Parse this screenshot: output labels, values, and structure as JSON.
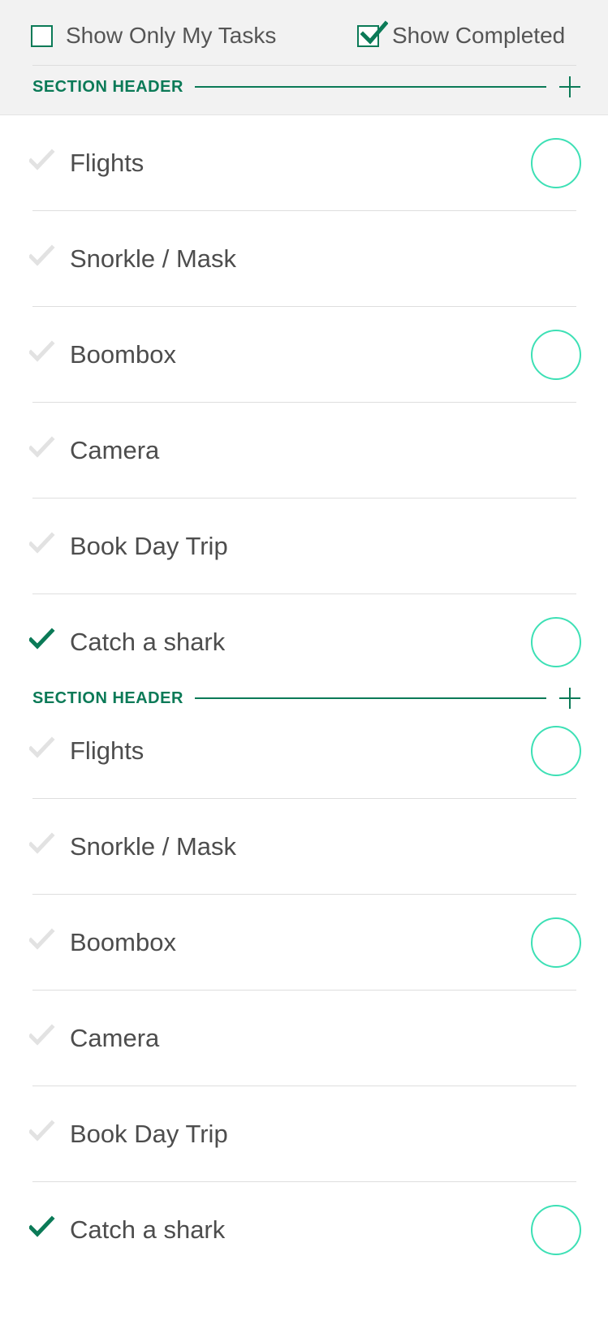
{
  "colors": {
    "accent": "#0b7a57",
    "ring": "#3de0b5",
    "check_inactive": "#e2e2e2",
    "text": "#4d4d4d"
  },
  "filters": {
    "show_only_my_tasks": {
      "label": "Show Only My Tasks",
      "checked": false
    },
    "show_completed": {
      "label": "Show Completed",
      "checked": true
    }
  },
  "sections": [
    {
      "header": "SECTION HEADER",
      "tasks": [
        {
          "title": "Flights",
          "completed": false,
          "assignees": [
            "person-glasses-plaid",
            "person-faded"
          ]
        },
        {
          "title": "Snorkle / Mask",
          "completed": false,
          "assignees": [
            "person-sunglasses"
          ]
        },
        {
          "title": "Boombox",
          "completed": false,
          "assignees": [
            "person-brown",
            "person-faded"
          ]
        },
        {
          "title": "Camera",
          "completed": false,
          "assignees": [
            "person-glasses-plaid",
            "person-brown"
          ]
        },
        {
          "title": "Book Day Trip",
          "completed": false,
          "assignees": [
            "person-glasses-plaid"
          ]
        },
        {
          "title": "Catch a shark",
          "completed": true,
          "assignees": [
            "person-faded"
          ]
        }
      ]
    },
    {
      "header": "SECTION HEADER",
      "tasks": [
        {
          "title": "Flights",
          "completed": false,
          "assignees": [
            "person-glasses-plaid",
            "person-faded"
          ]
        },
        {
          "title": "Snorkle / Mask",
          "completed": false,
          "assignees": [
            "person-sunglasses"
          ]
        },
        {
          "title": "Boombox",
          "completed": false,
          "assignees": [
            "person-brown",
            "person-faded"
          ]
        },
        {
          "title": "Camera",
          "completed": false,
          "assignees": [
            "person-glasses-plaid",
            "person-brown"
          ]
        },
        {
          "title": "Book Day Trip",
          "completed": false,
          "assignees": [
            "person-glasses-plaid"
          ]
        },
        {
          "title": "Catch a shark",
          "completed": true,
          "assignees": [
            "person-faded"
          ]
        }
      ]
    }
  ]
}
